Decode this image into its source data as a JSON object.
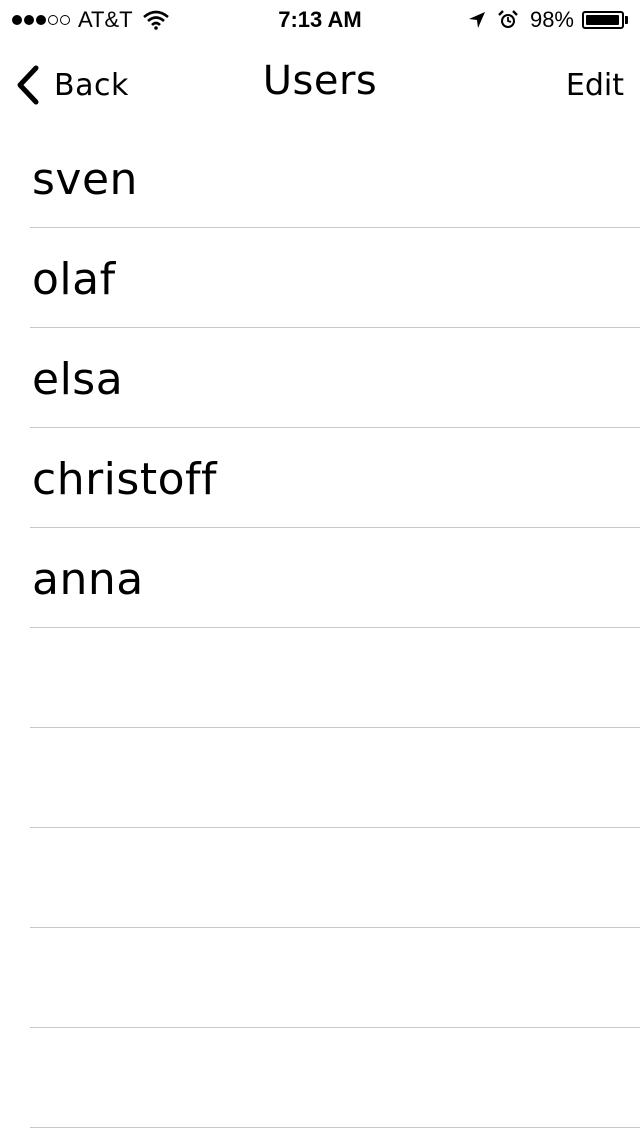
{
  "status_bar": {
    "signal_full": 3,
    "signal_empty": 2,
    "carrier": "AT&T",
    "time": "7:13 AM",
    "battery_percent": "98%",
    "battery_level": 0.98,
    "icons": [
      "wifi-icon",
      "location-icon",
      "alarm-icon",
      "battery-icon"
    ]
  },
  "nav": {
    "back_label": "Back",
    "title": "Users",
    "edit_label": "Edit"
  },
  "users": [
    "sven",
    "olaf",
    "elsa",
    "christoff",
    "anna"
  ],
  "empty_rows": 5,
  "colors": {
    "separator": "#c8c7cc",
    "text": "#000000",
    "background": "#ffffff"
  }
}
